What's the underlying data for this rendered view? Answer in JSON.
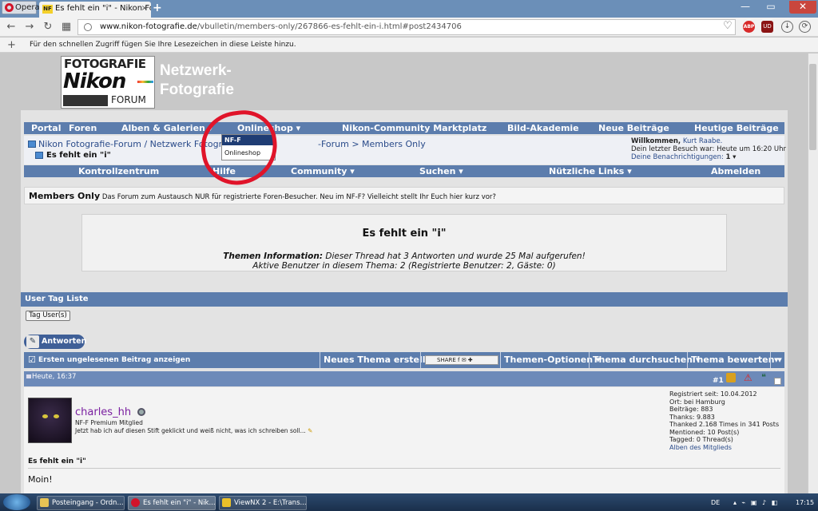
{
  "browser": {
    "menu_label": "Opera",
    "tab_favicon": "NF",
    "tab_title": "Es fehlt ein \"i\" - Nikon Fot",
    "url_domain": "www.nikon-fotografie.de",
    "url_path": "/vbulletin/members-only/267866-es-fehlt-ein-i.html#post2434706",
    "ext_abp": "ABP",
    "ext_two": "UD",
    "bookmark_hint": "Für den schnellen Zugriff fügen Sie Ihre Lesezeichen in diese Leiste hinzu."
  },
  "logo": {
    "line1": "FOTOGRAFIE",
    "line2": "Nikon",
    "line3": "FORUM"
  },
  "site_name_1": "Netzwerk-",
  "site_name_2": "Fotografie",
  "nav_top": {
    "portal": "Portal",
    "foren": "Foren",
    "alben": "Alben & Galerien",
    "onlineshop": "Onlineshop",
    "marktplatz": "Nikon-Community Marktplatz",
    "akademie": "Bild-Akademie",
    "neue": "Neue Beiträge",
    "heutige": "Heutige Beiträge"
  },
  "breadcrumb": {
    "path": "Nikon Fotografie-Forum / Netzwerk Fotografie",
    "sep": ">",
    "rest": "-Forum > Members Only",
    "current": "Es fehlt ein \"i\""
  },
  "dropdown": {
    "header": "NF-F Onlineshop",
    "item": "Onlineshop"
  },
  "welcome": {
    "greeting": "Willkommen,",
    "user": "Kurt Raabe.",
    "last_visit": "Dein letzter Besuch war: Heute um 16:20 Uhr",
    "notifications_label": "Deine Benachrichtigungen:",
    "notifications_count": "1"
  },
  "nav_second": {
    "kontroll": "Kontrollzentrum",
    "hilfe": "Hilfe",
    "community": "Community",
    "suchen": "Suchen",
    "links": "Nützliche Links",
    "abmelden": "Abmelden"
  },
  "members": {
    "title": "Members Only",
    "desc": "Das Forum zum Austausch NUR für registrierte Foren-Besucher. Neu im NF-F? Vielleicht stellt Ihr Euch hier kurz vor?"
  },
  "thread": {
    "title": "Es fehlt ein \"i\"",
    "info_label": "Themen Information:",
    "info_text": "Dieser Thread hat 3 Antworten und wurde 25 Mal aufgerufen!",
    "users_text": "Aktive Benutzer in diesem Thema: 2 (Registrierte Benutzer: 2, Gäste: 0)"
  },
  "usertag": {
    "title": "User Tag Liste",
    "button": "Tag User(s)"
  },
  "reply_button": "Antworten",
  "toolbar": {
    "first_unread": "Ersten ungelesenen Beitrag anzeigen",
    "new_thread": "Neues Thema erstellen",
    "share": "SHARE",
    "options": "Themen-Optionen",
    "search": "Thema durchsuchen",
    "rate": "Thema bewerten"
  },
  "post": {
    "time": "Heute, 16:37",
    "number": "#1",
    "username": "charles_hh",
    "usertitle": "NF-F Premium Mitglied",
    "signature": "Jetzt hab ich auf diesen Stift geklickt und weiß nicht, was ich schreiben soll...",
    "stats": [
      "Registriert seit: 10.04.2012",
      "Ort: bei Hamburg",
      "Beiträge: 883",
      "Thanks: 9.883",
      "Thanked 2.168 Times in 341 Posts",
      "Mentioned: 10 Post(s)",
      "Tagged: 0 Thread(s)"
    ],
    "albums_link": "Alben des Mitglieds",
    "title": "Es fehlt ein \"i\"",
    "body": "Moin!"
  },
  "taskbar": {
    "task1": "Posteingang - Ordn...",
    "task2": "Es fehlt ein \"i\" - Nik...",
    "task3": "ViewNX 2 - E:\\Trans...",
    "lang": "DE",
    "time": "17:15"
  }
}
